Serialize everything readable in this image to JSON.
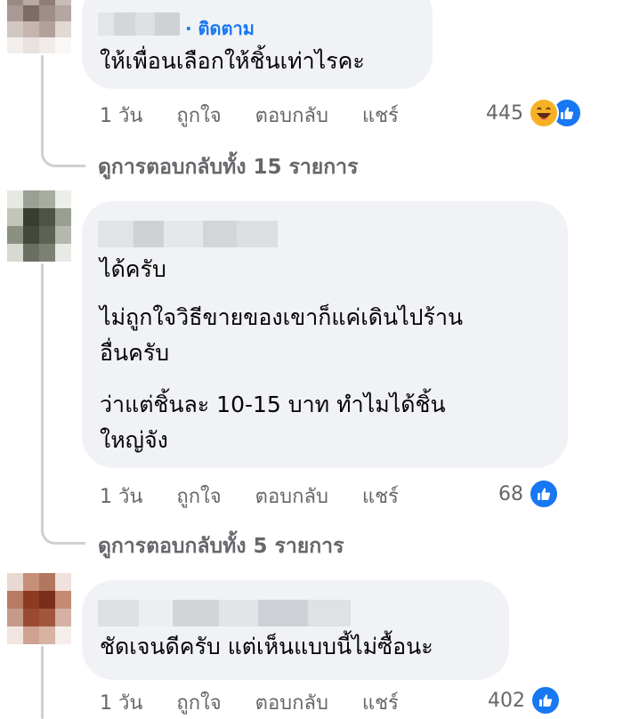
{
  "comments": [
    {
      "follow_label": "· ติดตาม",
      "lines": [
        "ให้เพื่อนเลือกให้ชิ้นเท่าไรคะ"
      ],
      "actions": {
        "time": "1 วัน",
        "like": "ถูกใจ",
        "reply": "ตอบกลับ",
        "share": "แชร์"
      },
      "reaction_count": "445",
      "reaction_icons": [
        "haha-icon",
        "like-icon"
      ],
      "view_replies": "ดูการตอบกลับทั้ง 15 รายการ"
    },
    {
      "lines": [
        "ได้ครับ",
        "ไม่ถูกใจวิธีขายของเขาก็แค่เดินไปร้าน",
        "อื่นครับ",
        "ว่าแต่ชิ้นละ 10-15 บาท ทำไมได้ชิ้น",
        "ใหญ่จัง"
      ],
      "actions": {
        "time": "1 วัน",
        "like": "ถูกใจ",
        "reply": "ตอบกลับ",
        "share": "แชร์"
      },
      "reaction_count": "68",
      "reaction_icons": [
        "like-icon"
      ],
      "view_replies": "ดูการตอบกลับทั้ง 5 รายการ"
    },
    {
      "lines": [
        "ชัดเจนดีครับ แต่เห็นแบบนี้ไม่ซื้อนะ"
      ],
      "actions": {
        "time": "1 วัน",
        "like": "ถูกใจ",
        "reply": "ตอบกลับ",
        "share": "แชร์"
      },
      "reaction_count": "402",
      "reaction_icons": [
        "like-icon"
      ]
    }
  ],
  "colors": {
    "bubble": "#f0f2f5",
    "link_blue": "#1877f2",
    "secondary_text": "#65676b",
    "thread_line": "#ced0d4"
  }
}
